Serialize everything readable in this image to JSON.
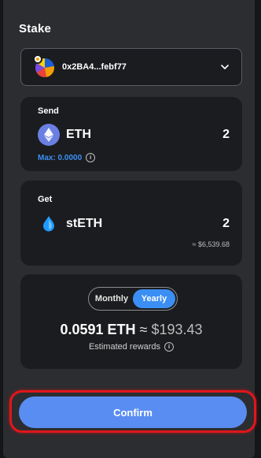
{
  "header": {
    "title": "Stake"
  },
  "account": {
    "name": "0x2BA4...febf77"
  },
  "send": {
    "label": "Send",
    "token": "ETH",
    "amount": "2",
    "max_text": "Max: 0.0000"
  },
  "get": {
    "label": "Get",
    "token": "stETH",
    "amount": "2",
    "usd_value": "≈ $6,539.68"
  },
  "rewards": {
    "toggle": {
      "options": [
        "Monthly",
        "Yearly"
      ],
      "selected": "Yearly"
    },
    "amount_eth": "0.0591 ETH",
    "approx": "≈",
    "amount_usd": "$193.43",
    "caption": "Estimated rewards"
  },
  "actions": {
    "confirm_label": "Confirm"
  },
  "colors": {
    "accent": "#3b8ff4",
    "confirm": "#5a8df2",
    "highlight": "#e0161b",
    "eth_icon": "#6a7fe2",
    "steth_icon": "#1e9bff"
  },
  "icons": {
    "account": "avatar",
    "dropdown": "chevron-down-icon",
    "send_token": "eth-icon",
    "get_token": "steth-icon",
    "info": "info-icon"
  }
}
